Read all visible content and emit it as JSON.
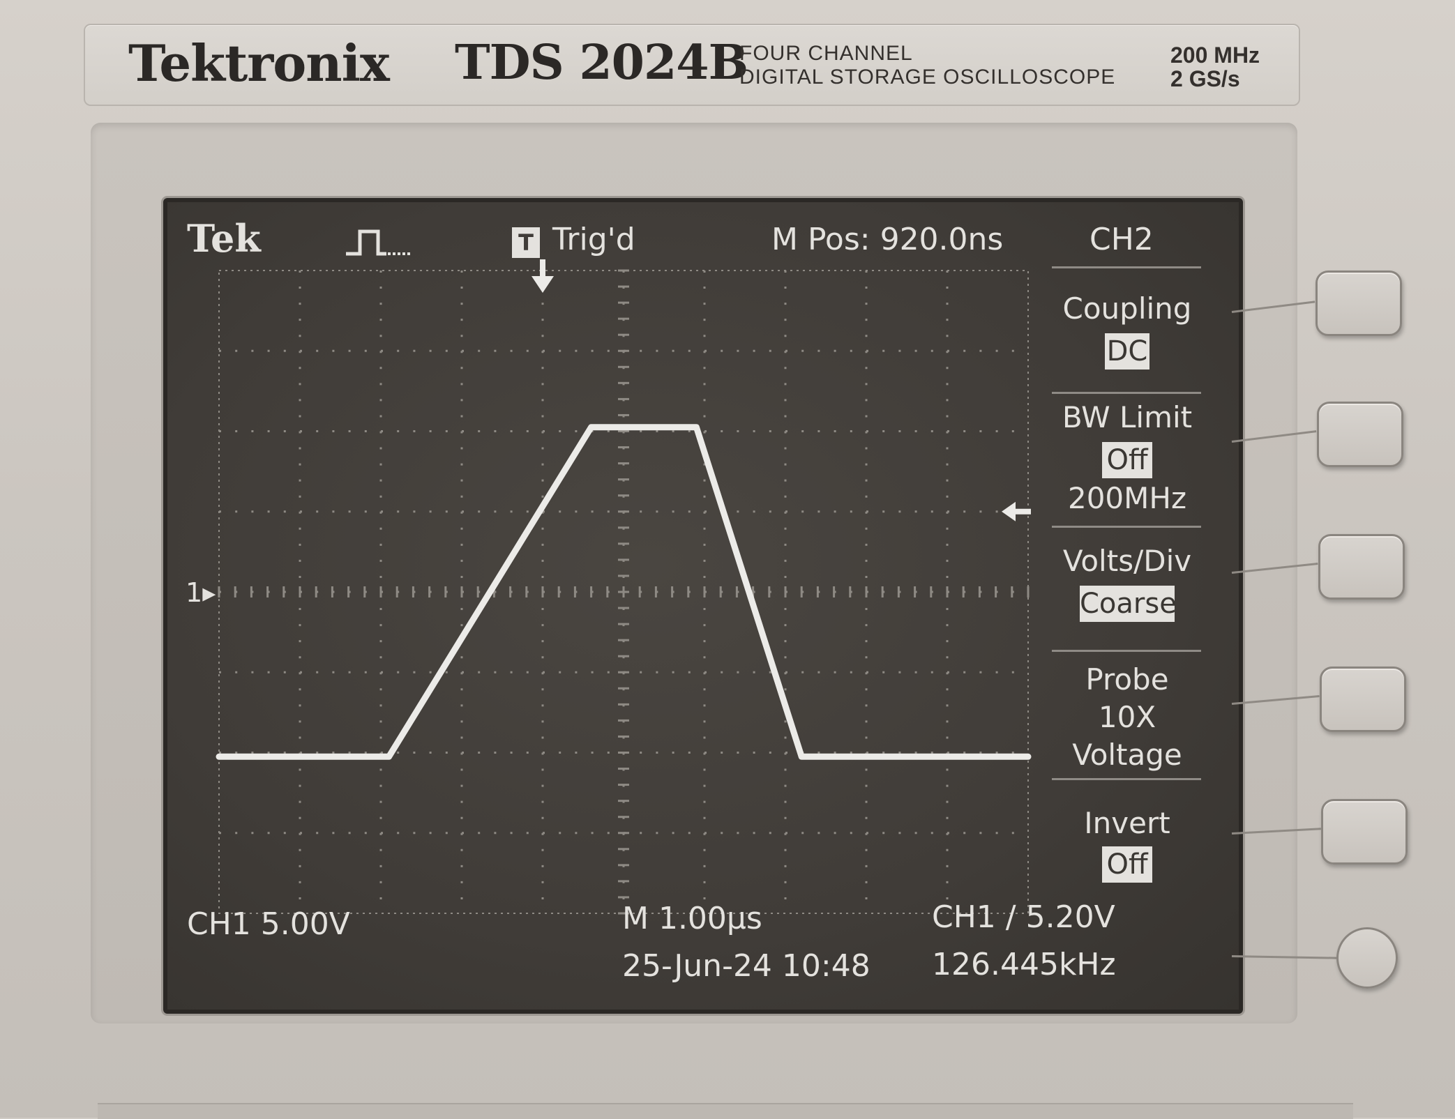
{
  "brand": {
    "logo": "Tektronix",
    "model": "TDS 2024B",
    "description_line1": "FOUR  CHANNEL",
    "description_line2": "DIGITAL STORAGE OSCILLOSCOPE",
    "spec_bandwidth": "200 MHz",
    "spec_sample_rate": "2 GS/s"
  },
  "status_bar": {
    "tek_label": "Tek",
    "trigger_icon": "run-pulse-icon",
    "trigger_badge": "T",
    "trigger_status": "Trig'd",
    "m_pos": "M Pos: 920.0ns",
    "menu_channel": "CH2"
  },
  "side_menu": [
    {
      "title": "Coupling",
      "value": "DC"
    },
    {
      "title": "BW Limit",
      "value": "Off",
      "subvalue": "200MHz"
    },
    {
      "title": "Volts/Div",
      "value": "Coarse"
    },
    {
      "title": "Probe",
      "line2": "10X",
      "line3": "Voltage"
    },
    {
      "title": "Invert",
      "value": "Off"
    }
  ],
  "channel_marker": "1",
  "readouts": {
    "ch1_scale": "CH1  5.00V",
    "timebase": "M 1.00µs",
    "datetime": "25-Jun-24 10:48",
    "trigger_readout": "CH1 ∕ 5.20V",
    "frequency": "126.445kHz"
  },
  "chart_data": {
    "type": "line",
    "x_divisions": 10,
    "y_divisions": 8,
    "x_unit": "div",
    "y_unit": "div",
    "series": [
      {
        "x": [
          0.0,
          2.1,
          4.6,
          5.9,
          7.2,
          10.0
        ],
        "y": [
          -2.05,
          -2.05,
          2.05,
          2.05,
          -2.05,
          -2.05
        ]
      }
    ],
    "trigger_level_div": 1.0,
    "ground_level_div": 0.0,
    "trigger_position_div": 4.0,
    "grid": true
  },
  "colors": {
    "screen_bg": "#403c38",
    "trace": "#ecebe8",
    "graticule": "#8e8a84",
    "bezel": "#cfcac4"
  }
}
